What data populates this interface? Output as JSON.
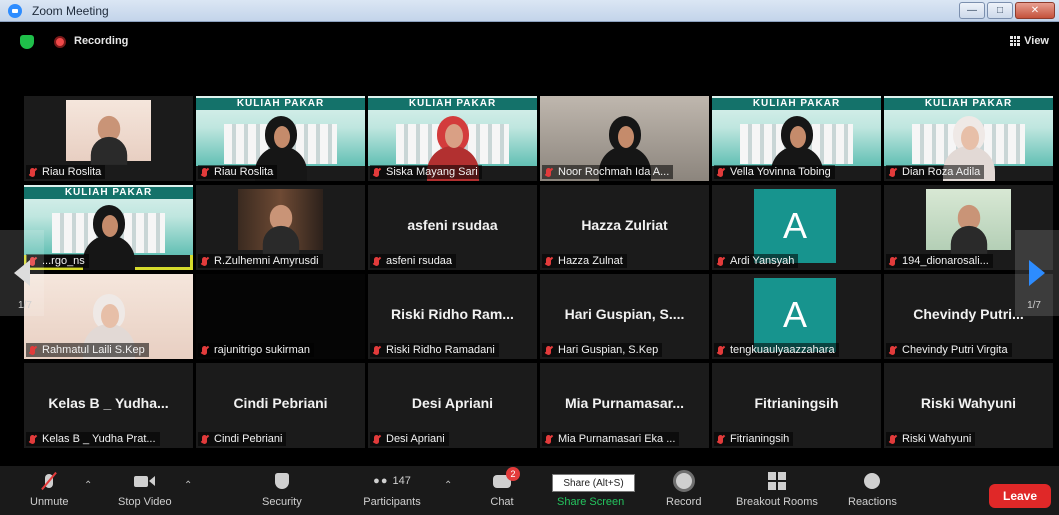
{
  "window": {
    "title": "Zoom Meeting",
    "controls": [
      "minimize",
      "maximize",
      "close"
    ]
  },
  "top": {
    "recording_label": "Recording",
    "view_label": "View"
  },
  "tiles": [
    {
      "name": "Riau Roslita",
      "display": "video"
    },
    {
      "name": "Riau Roslita",
      "display": "video"
    },
    {
      "name": "Siska Mayang Sari",
      "display": "video"
    },
    {
      "name": "Noor Rochmah Ida A...",
      "display": "video"
    },
    {
      "name": "Vella Yovinna Tobing",
      "display": "video"
    },
    {
      "name": "Dian Roza Adila",
      "display": "video"
    },
    {
      "name": "...rgo_ns",
      "display": "video",
      "active_speaker": true
    },
    {
      "name": "R.Zulhemni Amyrusdi",
      "display": "video"
    },
    {
      "name": "asfeni rsudaa",
      "display": "name",
      "big_name": "asfeni rsudaa"
    },
    {
      "name": "Hazza Zulnat",
      "display": "name",
      "big_name": "Hazza Zulriat"
    },
    {
      "name": "Ardi Yansyah",
      "display": "avatar",
      "letter": "A"
    },
    {
      "name": "194_dionarosali...",
      "display": "video"
    },
    {
      "name": "Rahmatul Laili S.Kep",
      "display": "video"
    },
    {
      "name": "rajunitrigo sukirman",
      "display": "black"
    },
    {
      "name": "Riski Ridho Ramadani",
      "display": "name",
      "big_name": "Riski Ridho Ram..."
    },
    {
      "name": "Hari Guspian, S.Kep",
      "display": "name",
      "big_name": "Hari Guspian, S...."
    },
    {
      "name": "tengkuaulyaazzahara",
      "display": "avatar",
      "letter": "A"
    },
    {
      "name": "Chevindy Putri Virgita",
      "display": "name",
      "big_name": "Chevindy Putri..."
    },
    {
      "name": "Kelas B _ Yudha Prat...",
      "display": "name",
      "big_name": "Kelas B _ Yudha..."
    },
    {
      "name": "Cindi Pebriani",
      "display": "name",
      "big_name": "Cindi Pebriani"
    },
    {
      "name": "Desi Apriani",
      "display": "name",
      "big_name": "Desi Apriani"
    },
    {
      "name": "Mia Purnamasari Eka ...",
      "display": "name",
      "big_name": "Mia Purnamasar..."
    },
    {
      "name": "Fitrianingsih",
      "display": "name",
      "big_name": "Fitrianingsih"
    },
    {
      "name": "Riski Wahyuni",
      "display": "name",
      "big_name": "Riski Wahyuni"
    }
  ],
  "banner_text": "KULIAH PAKAR",
  "pagination": {
    "left": "1/7",
    "right": "1/7"
  },
  "toolbar": {
    "unmute": "Unmute",
    "stop_video": "Stop Video",
    "security": "Security",
    "participants": "Participants",
    "participants_count": "147",
    "chat": "Chat",
    "chat_badge": "2",
    "share_screen": "Share Screen",
    "share_tooltip": "Share (Alt+S)",
    "record": "Record",
    "breakout_rooms": "Breakout Rooms",
    "reactions": "Reactions",
    "leave": "Leave"
  },
  "colors": {
    "accent": "#2d8cff",
    "share_green": "#24c35e",
    "leave_red": "#e02828",
    "active_speaker": "#d6db2c",
    "avatar_teal": "#17948e"
  }
}
